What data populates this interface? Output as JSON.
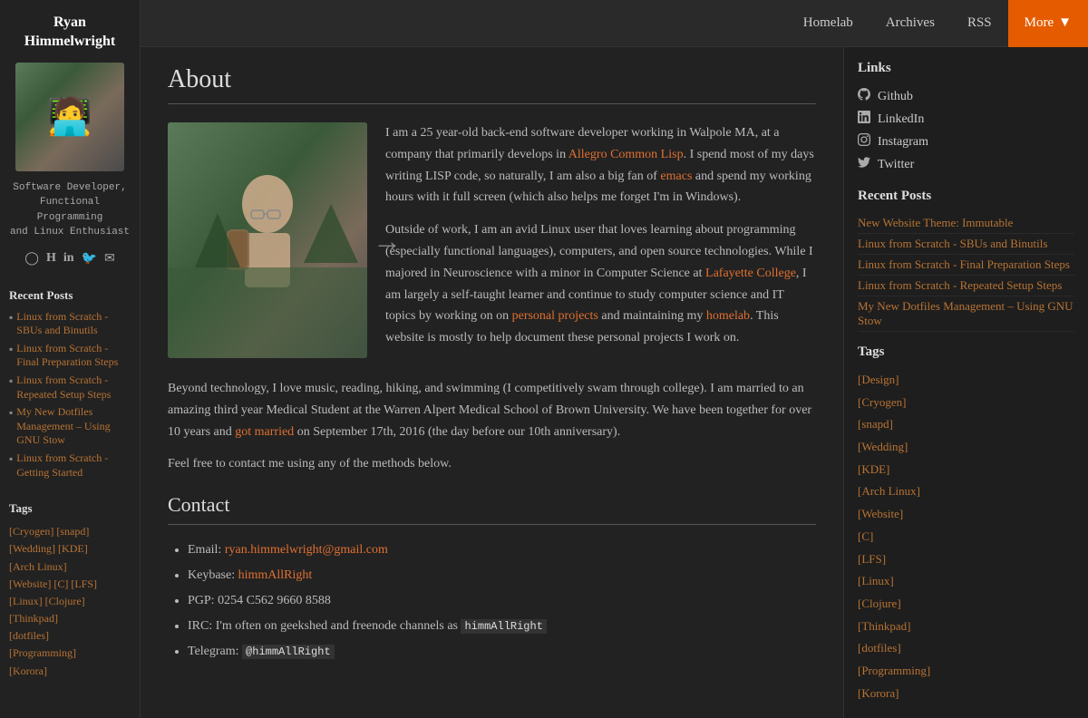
{
  "site": {
    "author_name": "Ryan Himmelwright",
    "tagline": "Software Developer,\nFunctional Programming\nand Linux Enthusiast"
  },
  "nav": {
    "homelab": "Homelab",
    "archives": "Archives",
    "rss": "RSS",
    "more": "More"
  },
  "sidebar_left": {
    "recent_posts_title": "Recent Posts",
    "posts": [
      "Linux from Scratch - SBUs and Binutils",
      "Linux from Scratch - Final Preparation Steps",
      "Linux from Scratch - Repeated Setup Steps",
      "My New Dotfiles Management – Using GNU Stow",
      "Linux from Scratch - Getting Started"
    ],
    "tags_title": "Tags",
    "tags": "[Cryogen] [snapd] [Wedding] [KDE] [Arch Linux] [Website] [C] [LFS] [Linux] [Clojure] [Thinkpad] [dotfiles] [Programming] [Korora]"
  },
  "article": {
    "title": "About",
    "contact_title": "Contact",
    "intro_p1": "I am a 25 year-old back-end software developer working in Walpole MA, at a company that primarily develops in Allegro Common Lisp. I spend most of my days writing LISP code, so naturally, I am also a big fan of emacs and spend my working hours with it full screen (which also helps me forget I'm in Windows).",
    "intro_p2": "Outside of work, I am an avid Linux user that loves learning about programming (especially functional languages), computers, and open source technologies. While I majored in Neuroscience with a minor in Computer Science at Lafayette College, I am largely a self-taught learner and continue to study computer science and IT topics by working on on personal projects and maintaining my homelab. This website is mostly to help document these personal projects I work on.",
    "intro_p3": "Beyond technology, I love music, reading, hiking, and swimming (I competitively swam through college). I am married to an amazing third year Medical Student at the Warren Alpert Medical School of Brown University. We have been together for over 10 years and got married on September 17th, 2016 (the day before our 10th anniversary).",
    "contact_p": "Feel free to contact me using any of the methods below.",
    "email_label": "Email:",
    "email": "ryan.himmelwright@gmail.com",
    "keybase_label": "Keybase:",
    "keybase": "himmAllRight",
    "pgp_label": "PGP:",
    "pgp": "0254 C562 9660 8588",
    "irc_label": "IRC: I'm often on geekshed and freenode channels as",
    "irc_nick": "himmAllRight",
    "telegram_label": "Telegram:",
    "telegram_nick": "@himmAllRight"
  },
  "right_sidebar": {
    "links_title": "Links",
    "links": [
      {
        "label": "Github",
        "icon": "github"
      },
      {
        "label": "LinkedIn",
        "icon": "linkedin"
      },
      {
        "label": "Instagram",
        "icon": "instagram"
      },
      {
        "label": "Twitter",
        "icon": "twitter"
      }
    ],
    "recent_posts_title": "Recent Posts",
    "posts": [
      "New Website Theme: Immutable",
      "Linux from Scratch - SBUs and Binutils",
      "Linux from Scratch - Final Preparation Steps",
      "Linux from Scratch - Repeated Setup Steps",
      "My New Dotfiles Management – Using GNU Stow"
    ],
    "tags_title": "Tags",
    "tags": [
      "[Design]",
      "[Cryogen]",
      "[snapd]",
      "[Wedding]",
      "[KDE]",
      "[Arch Linux]",
      "[Website]",
      "[C]",
      "[LFS]",
      "[Linux]",
      "[Clojure]",
      "[Thinkpad]",
      "[dotfiles]",
      "[Programming]",
      "[Korora]"
    ]
  }
}
